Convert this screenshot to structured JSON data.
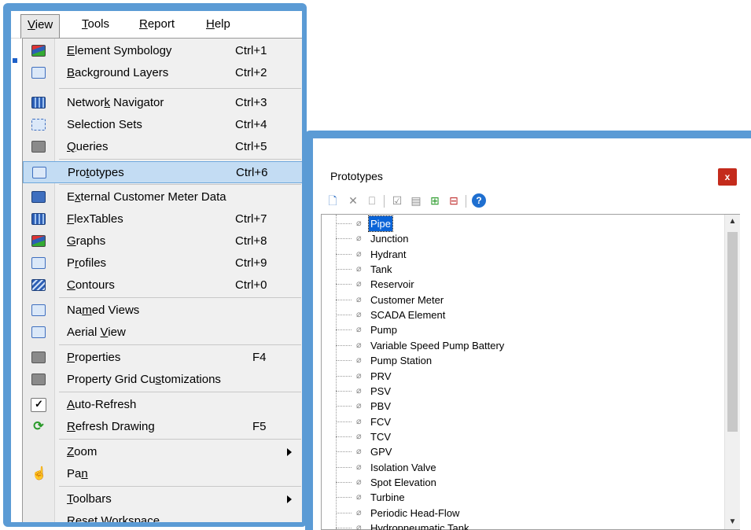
{
  "menubar": {
    "items": [
      {
        "pre": "",
        "ul": "V",
        "post": "iew"
      },
      {
        "pre": "",
        "ul": "T",
        "post": "ools"
      },
      {
        "pre": "",
        "ul": "R",
        "post": "eport"
      },
      {
        "pre": "",
        "ul": "H",
        "post": "elp"
      }
    ]
  },
  "view_menu": {
    "items": [
      {
        "pre": "",
        "ul": "E",
        "post": "lement Symbology",
        "shortcut": "Ctrl+1",
        "icon": "element-symbology-icon"
      },
      {
        "pre": "",
        "ul": "B",
        "post": "ackground Layers",
        "shortcut": "Ctrl+2",
        "icon": "background-layers-icon"
      },
      {
        "pre": "Networ",
        "ul": "k",
        "post": " Navigator",
        "shortcut": "Ctrl+3",
        "icon": "network-navigator-icon"
      },
      {
        "pre": "Selection Sets",
        "ul": "",
        "post": "",
        "shortcut": "Ctrl+4",
        "icon": "selection-sets-icon"
      },
      {
        "pre": "",
        "ul": "Q",
        "post": "ueries",
        "shortcut": "Ctrl+5",
        "icon": "queries-icon"
      },
      {
        "pre": "Pro",
        "ul": "t",
        "post": "otypes",
        "shortcut": "Ctrl+6",
        "icon": "prototypes-icon"
      },
      {
        "pre": "E",
        "ul": "x",
        "post": "ternal Customer Meter Data",
        "shortcut": "",
        "icon": "external-customer-meter-icon"
      },
      {
        "pre": "",
        "ul": "F",
        "post": "lexTables",
        "shortcut": "Ctrl+7",
        "icon": "flextables-icon"
      },
      {
        "pre": "",
        "ul": "G",
        "post": "raphs",
        "shortcut": "Ctrl+8",
        "icon": "graphs-icon"
      },
      {
        "pre": "P",
        "ul": "r",
        "post": "ofiles",
        "shortcut": "Ctrl+9",
        "icon": "profiles-icon"
      },
      {
        "pre": "",
        "ul": "C",
        "post": "ontours",
        "shortcut": "Ctrl+0",
        "icon": "contours-icon"
      },
      {
        "pre": "Na",
        "ul": "m",
        "post": "ed Views",
        "shortcut": "",
        "icon": "named-views-icon"
      },
      {
        "pre": "Aerial ",
        "ul": "V",
        "post": "iew",
        "shortcut": "",
        "icon": "aerial-view-icon"
      },
      {
        "pre": "",
        "ul": "P",
        "post": "roperties",
        "shortcut": "F4",
        "icon": "properties-icon"
      },
      {
        "pre": "Property Grid Cu",
        "ul": "s",
        "post": "tomizations",
        "shortcut": "",
        "icon": "property-grid-icon"
      },
      {
        "pre": "",
        "ul": "A",
        "post": "uto-Refresh",
        "shortcut": "",
        "icon": "check-icon"
      },
      {
        "pre": "",
        "ul": "R",
        "post": "efresh Drawing",
        "shortcut": "F5",
        "icon": "refresh-icon"
      },
      {
        "pre": "",
        "ul": "Z",
        "post": "oom",
        "shortcut": "",
        "icon": ""
      },
      {
        "pre": "Pa",
        "ul": "n",
        "post": "",
        "shortcut": "",
        "icon": "hand-icon"
      },
      {
        "pre": "",
        "ul": "T",
        "post": "oolbars",
        "shortcut": "",
        "icon": ""
      },
      {
        "pre": "Reset ",
        "ul": "W",
        "post": "orkspace...",
        "shortcut": "",
        "icon": ""
      }
    ]
  },
  "prototypes_panel": {
    "title": "Prototypes",
    "close_glyph": "x",
    "toolbar_icons": [
      "new-icon",
      "delete-icon",
      "rename-icon",
      "make-current-icon",
      "report-icon",
      "expand-all-icon",
      "collapse-all-icon",
      "help-icon"
    ],
    "items": [
      "Pipe",
      "Junction",
      "Hydrant",
      "Tank",
      "Reservoir",
      "Customer Meter",
      "SCADA Element",
      "Pump",
      "Variable Speed Pump Battery",
      "Pump Station",
      "PRV",
      "PSV",
      "PBV",
      "FCV",
      "TCV",
      "GPV",
      "Isolation Valve",
      "Spot Elevation",
      "Turbine",
      "Periodic Head-Flow",
      "Hydropneumatic Tank"
    ],
    "selected_item": "Pipe",
    "item_glyph": "⌀"
  }
}
